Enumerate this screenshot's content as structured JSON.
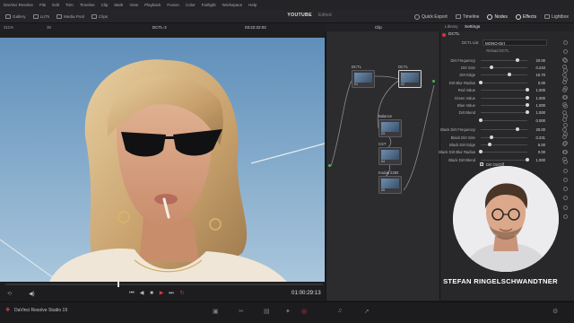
{
  "app": {
    "menu": [
      "DaVinci Resolve",
      "File",
      "Edit",
      "Trim",
      "Timeline",
      "Clip",
      "Mark",
      "View",
      "Playback",
      "Fusion",
      "Color",
      "Fairlight",
      "Workspace",
      "Help"
    ],
    "project_name": "YOUTUBE",
    "project_status": "Edited",
    "version": "DaVinci Resolve Studio 19"
  },
  "toolbar": {
    "left": [
      {
        "label": "Gallery",
        "icon": "gallery-icon"
      },
      {
        "label": "LUTs",
        "icon": "luts-icon"
      },
      {
        "label": "Media Pool",
        "icon": "media-pool-icon"
      },
      {
        "label": "Clips",
        "icon": "clips-icon"
      }
    ],
    "right": [
      {
        "label": "Quick Export",
        "icon": "export-icon"
      },
      {
        "label": "Timeline",
        "icon": "timeline-icon"
      },
      {
        "label": "Nodes",
        "icon": "nodes-icon"
      },
      {
        "label": "Effects",
        "icon": "effects-icon"
      },
      {
        "label": "Lightbox",
        "icon": "lightbox-icon"
      }
    ]
  },
  "viewer": {
    "zoom": "311%",
    "clip_name": "DCTL-2",
    "timecode": "03:22:22:02",
    "frame_number": "30",
    "transport_timecode": "01:00:29:13",
    "playhead_progress": 0.36
  },
  "node_editor": {
    "mode": "Clip",
    "nodes": [
      {
        "num": "01",
        "label": "DCTL"
      },
      {
        "num": "02",
        "label": "DCTL"
      },
      {
        "num": "03",
        "label": "Balance"
      },
      {
        "num": "04",
        "label": "CST"
      },
      {
        "num": "05",
        "label": "Kodak 2383"
      }
    ]
  },
  "inspector": {
    "tabs": [
      "Library",
      "Settings"
    ],
    "effect_title": "DCTL",
    "dctl_list_label": "DCTL List",
    "dctl_list_value": "MONO-Dirt",
    "reload_label": "Reload DCTL",
    "params": [
      {
        "label": "Dirt Frequency",
        "value": "20.00",
        "level": 0.78
      },
      {
        "label": "Dirt Size",
        "value": "0.243",
        "level": 0.24
      },
      {
        "label": "Dirt Edge",
        "value": "15.70",
        "level": 0.62
      },
      {
        "label": "Dirt Blur Radius",
        "value": "0.00",
        "level": 0.0
      },
      {
        "label": "Red Value",
        "value": "1.000",
        "level": 1.0
      },
      {
        "label": "Green Value",
        "value": "1.000",
        "level": 1.0
      },
      {
        "label": "Blue Value",
        "value": "1.000",
        "level": 1.0
      },
      {
        "label": "Dirt Blend",
        "value": "1.000",
        "level": 1.0
      },
      {
        "label": "",
        "value": "0.000",
        "level": 0.0
      },
      {
        "label": "Black Dirt Frequency",
        "value": "20.00",
        "level": 0.78
      },
      {
        "label": "Black Dirt Size",
        "value": "0.231",
        "level": 0.23
      },
      {
        "label": "Black Dirt Edge",
        "value": "5.00",
        "level": 0.2
      },
      {
        "label": "Black Dirt Blur Radius",
        "value": "0.00",
        "level": 0.0
      },
      {
        "label": "Black Dirt Blend",
        "value": "1.000",
        "level": 1.0
      }
    ],
    "checkbox_label": "Dirt On/Off",
    "checkbox_checked": true
  },
  "presenter": {
    "name": "STEFAN RINGELSCHWANDTNER"
  },
  "colors": {
    "accent_red": "#d8363a",
    "sky": "#7da9cc"
  }
}
